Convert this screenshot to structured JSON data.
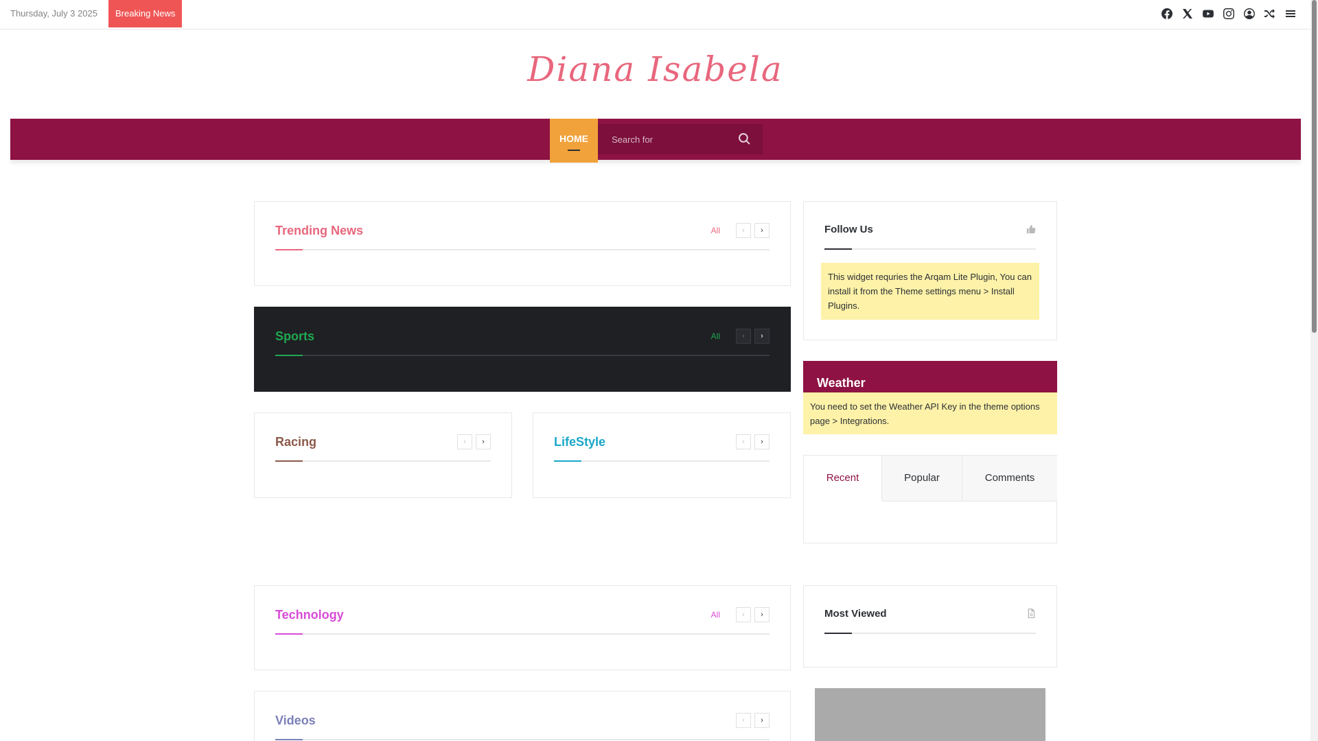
{
  "topbar": {
    "date": "Thursday, July 3 2025",
    "breaking": "Breaking News",
    "icons": [
      "facebook-icon",
      "x-twitter-icon",
      "youtube-icon",
      "instagram-icon",
      "login-icon",
      "random-icon",
      "sidebar-menu-icon"
    ]
  },
  "logo": {
    "text": "Diana Isabela",
    "color": "#e8677d"
  },
  "nav": {
    "home": "HOME",
    "search_placeholder": "Search for",
    "bg_color": "#8e1244",
    "active_color": "#f1a23a"
  },
  "blocks": {
    "trending": {
      "title": "Trending News",
      "all": "All",
      "color": "#e8677d"
    },
    "sports": {
      "title": "Sports",
      "all": "All",
      "color": "#1fa84f"
    },
    "racing": {
      "title": "Racing",
      "color": "#8c5a4a"
    },
    "lifestyle": {
      "title": "LifeStyle",
      "color": "#1aa7c8"
    },
    "technology": {
      "title": "Technology",
      "all": "All",
      "color": "#d84bd6"
    },
    "videos": {
      "title": "Videos",
      "color": "#7a7fb8"
    }
  },
  "sidebar": {
    "follow": {
      "title": "Follow Us",
      "notice": "This widget requries the Arqam Lite Plugin, You can install it from the Theme settings menu > Install Plugins."
    },
    "weather": {
      "title": "Weather",
      "notice": "You need to set the Weather API Key in the theme options page > Integrations."
    },
    "tabs": [
      "Recent",
      "Popular",
      "Comments"
    ],
    "most_viewed": {
      "title": "Most Viewed"
    }
  }
}
